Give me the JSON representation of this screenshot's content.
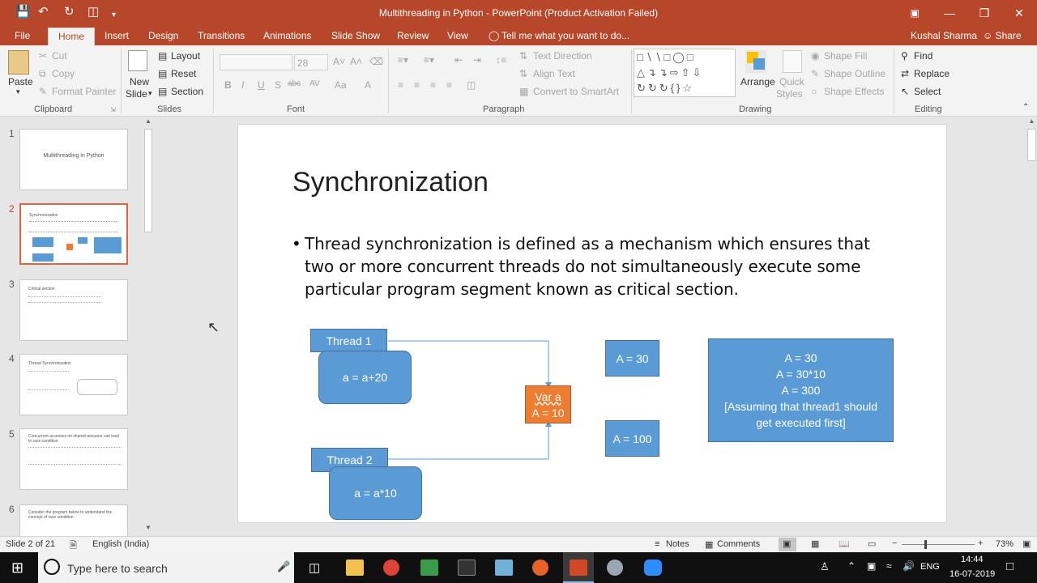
{
  "window": {
    "title": "Multithreading in Python - PowerPoint (Product Activation Failed)",
    "user": "Kushal Sharma",
    "share_label": "Share"
  },
  "tabs": [
    "File",
    "Home",
    "Insert",
    "Design",
    "Transitions",
    "Animations",
    "Slide Show",
    "Review",
    "View"
  ],
  "tell_me": "Tell me what you want to do...",
  "ribbon": {
    "clipboard": {
      "paste": "Paste",
      "cut": "Cut",
      "copy": "Copy",
      "format_painter": "Format Painter",
      "group": "Clipboard"
    },
    "slides": {
      "new_slide_1": "New",
      "new_slide_2": "Slide",
      "layout": "Layout",
      "reset": "Reset",
      "section": "Section",
      "group": "Slides"
    },
    "font": {
      "size": "28",
      "bold": "B",
      "italic": "I",
      "underline": "U",
      "shadow": "S",
      "strike": "abc",
      "spacing": "AV",
      "case": "Aa",
      "group": "Font"
    },
    "paragraph": {
      "text_direction": "Text Direction",
      "align_text": "Align Text",
      "convert_smartart": "Convert to SmartArt",
      "group": "Paragraph"
    },
    "drawing": {
      "arrange": "Arrange",
      "quick_styles_1": "Quick",
      "quick_styles_2": "Styles",
      "shape_fill": "Shape Fill",
      "shape_outline": "Shape Outline",
      "shape_effects": "Shape Effects",
      "group": "Drawing"
    },
    "editing": {
      "find": "Find",
      "replace": "Replace",
      "select": "Select",
      "group": "Editing"
    }
  },
  "thumbnails": [
    {
      "num": "1",
      "title": "Multithreading in Python"
    },
    {
      "num": "2",
      "title": "Synchronization"
    },
    {
      "num": "3",
      "title": "Critical section"
    },
    {
      "num": "4",
      "title": "Thread Synchronization"
    },
    {
      "num": "5",
      "title": "Concurrent accesses on shared resource can lead to race condition"
    },
    {
      "num": "6",
      "title": "Consider the program below to understand the concept of race condition"
    }
  ],
  "slide": {
    "title": "Synchronization",
    "bullet": "Thread synchronization is defined as a mechanism which ensures that two or more concurrent threads do not simultaneously execute some particular program segment known as critical section.",
    "thread1_label": "Thread 1",
    "thread1_code": "a = a+20",
    "thread2_label": "Thread 2",
    "thread2_code": "a = a*10",
    "var_line1": "Var a",
    "var_line2": "A = 10",
    "a30": "A = 30",
    "a100": "A = 100",
    "result": [
      "A = 30",
      "A = 30*10",
      "A = 300",
      "[Assuming that thread1 should",
      "get executed first]"
    ]
  },
  "status": {
    "slide_info": "Slide 2 of 21",
    "language": "English (India)",
    "notes": "Notes",
    "comments": "Comments",
    "zoom": "73%"
  },
  "taskbar": {
    "search_placeholder": "Type here to search",
    "language": "ENG",
    "time": "14:44",
    "date": "16-07-2019"
  },
  "colors": {
    "accent": "#b7472a",
    "shape_blue": "#5b9bd5",
    "shape_orange": "#ed7d31"
  }
}
